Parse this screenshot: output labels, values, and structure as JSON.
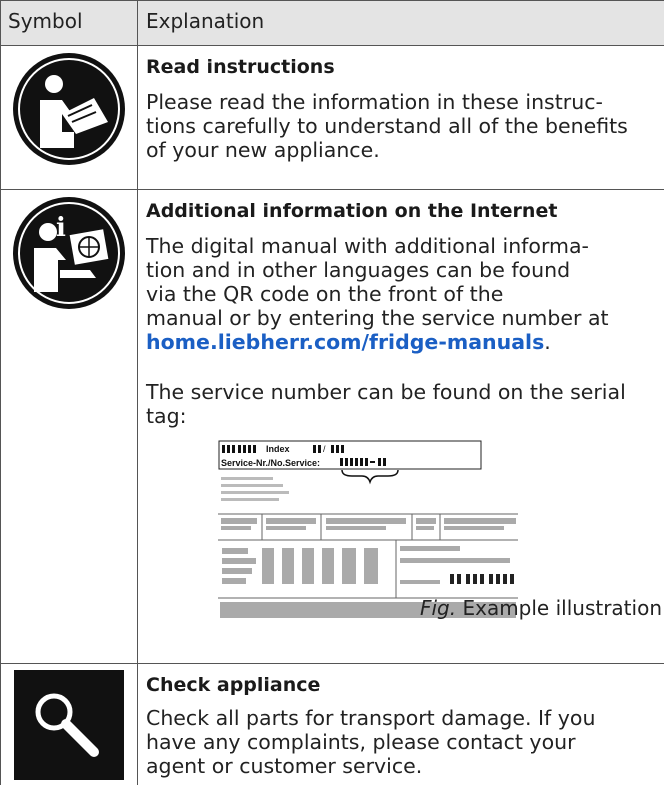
{
  "table": {
    "header": {
      "symbol": "Symbol",
      "explanation": "Explanation"
    },
    "rows": [
      {
        "icon": "read-instructions-icon",
        "title": "Read instructions",
        "lines": [
          "Please read the information in these instruc-",
          "tions carefully to understand all of the benefits",
          "of your new appliance."
        ]
      },
      {
        "icon": "internet-info-icon",
        "title": "Additional information on the Internet",
        "lines": [
          "The digital manual with additional informa-",
          "tion and in other languages can be found",
          "via the QR code on the front of the",
          "manual or by entering the service number at"
        ],
        "link": "home.liebherr.com/fridge-manuals",
        "link_suffix": ".",
        "serial_lines": [
          "The service number can be found on the serial",
          "tag:"
        ],
        "serial_tag": {
          "index_label": "Index",
          "service_label": "Service-Nr./No.Service:"
        },
        "caption_fig": "Fig.",
        "caption_text": "Example illustration"
      },
      {
        "icon": "magnifier-icon",
        "title": "Check appliance",
        "lines": [
          "Check all parts for transport damage. If you",
          "have any complaints, please contact your",
          "agent or customer service."
        ]
      }
    ]
  }
}
